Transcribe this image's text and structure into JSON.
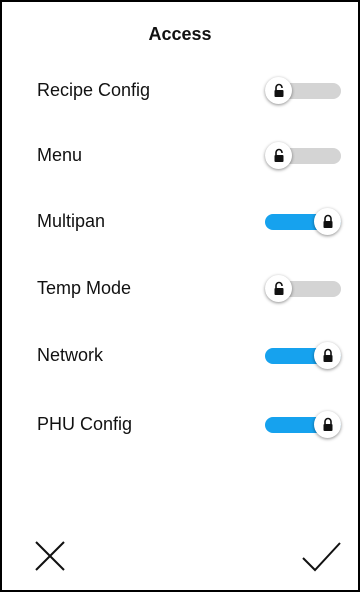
{
  "header": {
    "title": "Access"
  },
  "settings": [
    {
      "label": "Recipe Config",
      "state": "off",
      "icon": "unlocked-padlock-icon"
    },
    {
      "label": "Menu",
      "state": "off",
      "icon": "unlocked-padlock-icon"
    },
    {
      "label": "Multipan",
      "state": "on",
      "icon": "locked-padlock-icon"
    },
    {
      "label": "Temp Mode",
      "state": "off",
      "icon": "unlocked-padlock-icon"
    },
    {
      "label": "Network",
      "state": "on",
      "icon": "locked-padlock-icon"
    },
    {
      "label": "PHU Config",
      "state": "on",
      "icon": "locked-padlock-icon"
    }
  ],
  "footer": {
    "cancel_icon": "close-icon",
    "confirm_icon": "checkmark-icon"
  },
  "colors": {
    "toggle_on": "#16a2ee",
    "toggle_off": "#d4d4d4",
    "text": "#111111",
    "border": "#000000"
  }
}
